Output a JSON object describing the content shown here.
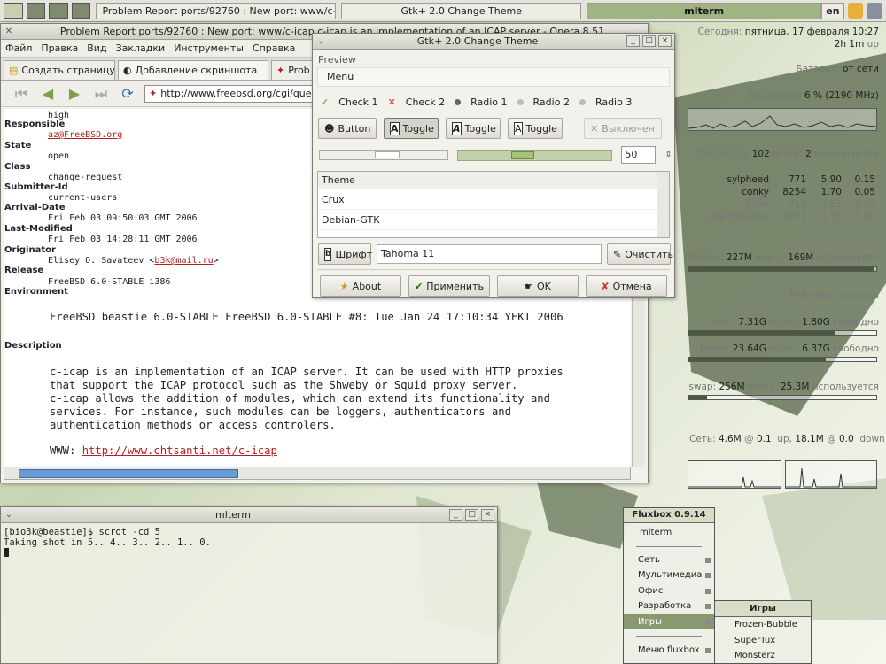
{
  "topbar": {
    "tasks": [
      "Problem Report ports/92760 : New port: www/c-icap c-ic",
      "Gtk+ 2.0 Change Theme",
      "mlterm"
    ],
    "lang": "en"
  },
  "opera": {
    "title": "Problem Report ports/92760 : New port: www/c-icap c-icap is an implementation of an ICAP server - Opera 8.51",
    "menu": [
      "Файл",
      "Правка",
      "Вид",
      "Закладки",
      "Инструменты",
      "Справка"
    ],
    "tabs": [
      "Создать страницу",
      "Добавление скриншота",
      "Prob"
    ],
    "address": "http://www.freebsd.org/cgi/query",
    "fields": [
      {
        "label": "",
        "value": "high"
      },
      {
        "label": "Responsible",
        "value": "az@FreeBSD.org"
      },
      {
        "label": "State",
        "value": "open"
      },
      {
        "label": "Class",
        "value": "change-request"
      },
      {
        "label": "Submitter-Id",
        "value": "current-users"
      },
      {
        "label": "Arrival-Date",
        "value": "Fri Feb 03 09:50:03 GMT 2006"
      },
      {
        "label": "Last-Modified",
        "value": "Fri Feb 03 14:28:11 GMT 2006"
      },
      {
        "label": "Originator",
        "value": "Elisey O. Savateev <",
        "link": "b3k@mail.ru",
        "tail": ">"
      },
      {
        "label": "Release",
        "value": "FreeBSD 6.0-STABLE i386"
      },
      {
        "label": "Environment",
        "value": ""
      }
    ],
    "environment": "FreeBSD beastie 6.0-STABLE FreeBSD 6.0-STABLE #8: Tue Jan 24 17:10:34 YEKT 2006",
    "description_label": "Description",
    "description": [
      "c-icap is an implementation of an ICAP server. It can be used with HTTP proxies",
      "that support the ICAP protocol such as the Shweby or Squid proxy server.",
      "c-icap allows the addition of modules, which can extend its functionality and",
      "services. For instance, such modules can be loggers, authenticators and",
      "authentication methods or access controlers."
    ],
    "www_label": "WWW: ",
    "www_link": "http://www.chtsanti.net/c-icap"
  },
  "gtk": {
    "title": "Gtk+ 2.0 Change Theme",
    "preview_label": "Preview",
    "menu_label": "Menu",
    "check1": "Check 1",
    "check2": "Check 2",
    "radio1": "Radio 1",
    "radio2": "Radio 2",
    "radio3": "Radio 3",
    "button": "Button",
    "toggle": "Toggle",
    "disabled": "Выключен",
    "spin_value": "50",
    "slider_position": 0.42,
    "theme_header": "Theme",
    "themes": [
      "Crux",
      "Debian-GTK"
    ],
    "font_button": "Шрифт",
    "font_value": "Tahoma 11",
    "clear_button": "Очистить",
    "about": "About",
    "apply": "Применить",
    "ok": "OK",
    "cancel": "Отмена"
  },
  "terminal": {
    "title": "mlterm",
    "lines": [
      "[bio3k@beastie]$ scrot -cd 5",
      "Taking shot in 5.. 4.. 3.. 2.. 1.. 0."
    ]
  },
  "conky": {
    "today_label": "Сегодня:",
    "today": "пятница, 17 февраля 10:27",
    "uptime_value": "2h 1m",
    "uptime_label": "up",
    "battery_label": "Батарея:",
    "battery": "от сети",
    "cpu_label": "Процессор:",
    "cpu": "6 % (2190 MHz)",
    "procs_label": "Процессы:",
    "procs_total": "102",
    "procs_total_label": "всего,",
    "procs_running": "2",
    "procs_running_label": "исполняются",
    "processes": [
      {
        "name": "sylpheed",
        "pid": "771",
        "mem": "5.90",
        "cpu": "0.15"
      },
      {
        "name": "conky",
        "pid": "8254",
        "mem": "1.70",
        "cpu": "0.05"
      },
      {
        "name": "gaim",
        "pid": "712",
        "mem": "4.63",
        "cpu": "0.00"
      },
      {
        "name": "gtk-chtheme",
        "pid": "7873",
        "mem": "4.15",
        "cpu": "0.00"
      }
    ],
    "memory_label": "Память:",
    "memory_used": "227M",
    "memory_total_label": "всего,",
    "memory_total": "169M",
    "memory_used_label": "используется",
    "memory_fraction": 0.99,
    "fs_title": "Файловая система",
    "root_label": "root:",
    "root_total": "7.31G",
    "root_total_label": "всего,",
    "root_free": "1.80G",
    "root_free_label": "свободно",
    "root_fraction": 0.78,
    "home_label": "home:",
    "home_total": "23.64G",
    "home_total_label": "всего,",
    "home_free": "6.37G",
    "home_free_label": "свободно",
    "home_fraction": 0.73,
    "swap_label": "swap:",
    "swap_total": "256M",
    "swap_total_label": "всего,",
    "swap_used": "25.3M",
    "swap_used_label": "используется",
    "swap_fraction": 0.1,
    "net_label": "Сеть:",
    "net_up": "4.6M",
    "net_up_rate": "0.1",
    "net_up_label": "up,",
    "net_down": "18.1M",
    "net_down_rate": "0.0",
    "net_down_label": "down"
  },
  "fluxbox": {
    "title": "Fluxbox 0.9.14",
    "items": [
      "mlterm",
      "Сеть",
      "Мультимедиа",
      "Офис",
      "Разработка",
      "Игры",
      "Меню fluxbox"
    ],
    "games_title": "Игры",
    "games": [
      "Frozen-Bubble",
      "SuperTux",
      "Monsterz"
    ]
  },
  "colors": {
    "accent": "#9eb583",
    "link": "#b02222",
    "scroll": "#6b9bd3"
  }
}
